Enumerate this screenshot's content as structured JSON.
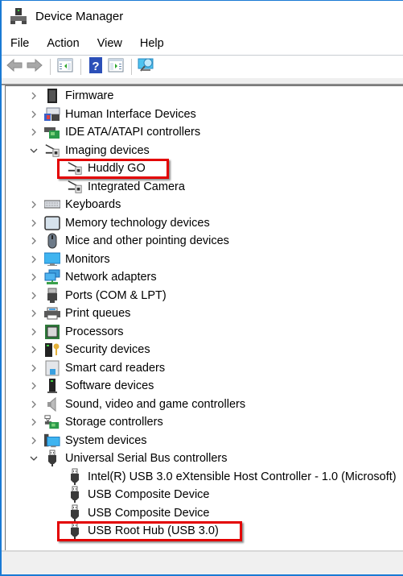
{
  "window": {
    "title": "Device Manager",
    "accent_color": "#1a7ad4"
  },
  "menu": [
    "File",
    "Action",
    "View",
    "Help"
  ],
  "toolbar": [
    {
      "icon": "back-arrow-icon"
    },
    {
      "icon": "forward-arrow-icon"
    },
    {
      "icon": "show-hide-console-tree-icon"
    },
    {
      "icon": "help-icon"
    },
    {
      "icon": "show-hide-action-pane-icon"
    },
    {
      "icon": "scan-hardware-changes-icon"
    }
  ],
  "tree": [
    {
      "label": "Firmware",
      "level": 0,
      "state": "collapsed",
      "icon": "firmware-chip-icon"
    },
    {
      "label": "Human Interface Devices",
      "level": 0,
      "state": "collapsed",
      "icon": "hid-icon"
    },
    {
      "label": "IDE ATA/ATAPI controllers",
      "level": 0,
      "state": "collapsed",
      "icon": "ide-controller-icon"
    },
    {
      "label": "Imaging devices",
      "level": 0,
      "state": "expanded",
      "icon": "camera-icon"
    },
    {
      "label": "Huddly GO",
      "level": 1,
      "state": "leaf",
      "icon": "camera-icon",
      "highlighted": true
    },
    {
      "label": "Integrated Camera",
      "level": 1,
      "state": "leaf",
      "icon": "camera-icon"
    },
    {
      "label": "Keyboards",
      "level": 0,
      "state": "collapsed",
      "icon": "keyboard-icon"
    },
    {
      "label": "Memory technology devices",
      "level": 0,
      "state": "collapsed",
      "icon": "memory-device-icon"
    },
    {
      "label": "Mice and other pointing devices",
      "level": 0,
      "state": "collapsed",
      "icon": "mouse-icon"
    },
    {
      "label": "Monitors",
      "level": 0,
      "state": "collapsed",
      "icon": "monitor-icon"
    },
    {
      "label": "Network adapters",
      "level": 0,
      "state": "collapsed",
      "icon": "network-adapter-icon"
    },
    {
      "label": "Ports (COM & LPT)",
      "level": 0,
      "state": "collapsed",
      "icon": "port-icon"
    },
    {
      "label": "Print queues",
      "level": 0,
      "state": "collapsed",
      "icon": "printer-icon"
    },
    {
      "label": "Processors",
      "level": 0,
      "state": "collapsed",
      "icon": "processor-icon"
    },
    {
      "label": "Security devices",
      "level": 0,
      "state": "collapsed",
      "icon": "security-device-icon"
    },
    {
      "label": "Smart card readers",
      "level": 0,
      "state": "collapsed",
      "icon": "smart-card-reader-icon"
    },
    {
      "label": "Software devices",
      "level": 0,
      "state": "collapsed",
      "icon": "software-device-icon"
    },
    {
      "label": "Sound, video and game controllers",
      "level": 0,
      "state": "collapsed",
      "icon": "speaker-icon"
    },
    {
      "label": "Storage controllers",
      "level": 0,
      "state": "collapsed",
      "icon": "storage-controller-icon"
    },
    {
      "label": "System devices",
      "level": 0,
      "state": "collapsed",
      "icon": "system-device-icon"
    },
    {
      "label": "Universal Serial Bus controllers",
      "level": 0,
      "state": "expanded",
      "icon": "usb-icon"
    },
    {
      "label": "Intel(R) USB 3.0 eXtensible Host Controller - 1.0 (Microsoft)",
      "level": 1,
      "state": "leaf",
      "icon": "usb-icon"
    },
    {
      "label": "USB Composite Device",
      "level": 1,
      "state": "leaf",
      "icon": "usb-icon"
    },
    {
      "label": "USB Composite Device",
      "level": 1,
      "state": "leaf",
      "icon": "usb-icon"
    },
    {
      "label": "USB Root Hub (USB 3.0)",
      "level": 1,
      "state": "leaf",
      "icon": "usb-icon",
      "highlighted": true
    }
  ],
  "annotation_color": "#e30000"
}
